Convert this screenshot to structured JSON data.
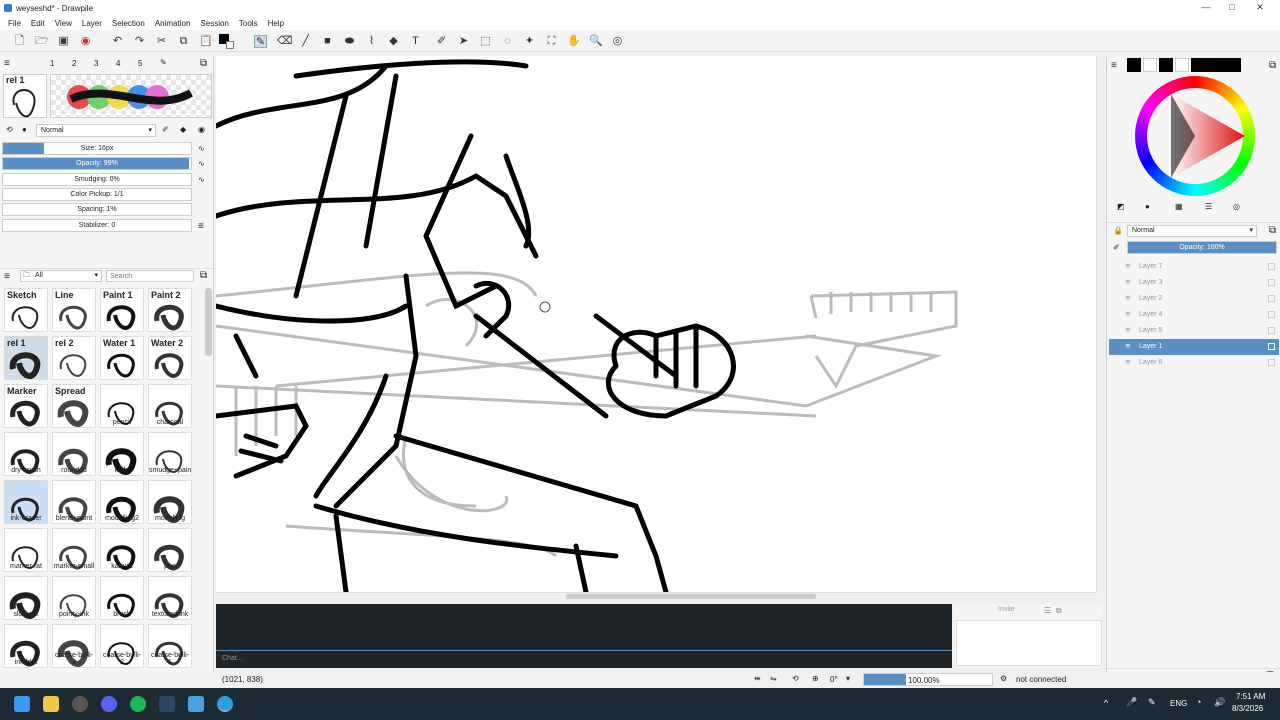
{
  "window": {
    "title": "weyseshd* - Drawpile",
    "minimize": "—",
    "maximize": "□",
    "close": "✕"
  },
  "menu": [
    "File",
    "Edit",
    "View",
    "Layer",
    "Selection",
    "Animation",
    "Session",
    "Tools",
    "Help"
  ],
  "brush_settings": {
    "preset_tabs": [
      "1",
      "2",
      "3",
      "4",
      "5"
    ],
    "current_brush": "rel 1",
    "blend_mode": "Normal",
    "sliders": [
      {
        "label": "Size: 16px",
        "fraction": 0.22
      },
      {
        "label": "Opacity: 99%",
        "fraction": 0.99
      },
      {
        "label": "Smudging: 0%",
        "fraction": 0
      },
      {
        "label": "Color Pickup: 1/1",
        "fraction": 0
      },
      {
        "label": "Spacing: 1%",
        "fraction": 0
      },
      {
        "label": "Stabilizer: 0",
        "fraction": 0
      }
    ]
  },
  "brushes": {
    "filter": "All",
    "search_placeholder": "Search",
    "items": [
      {
        "title": "Sketch",
        "label": ""
      },
      {
        "title": "Line",
        "label": ""
      },
      {
        "title": "Paint 1",
        "label": ""
      },
      {
        "title": "Paint 2",
        "label": ""
      },
      {
        "title": "rel 1",
        "label": ""
      },
      {
        "title": "rel 2",
        "label": ""
      },
      {
        "title": "Water 1",
        "label": ""
      },
      {
        "title": "Water 2",
        "label": ""
      },
      {
        "title": "Marker",
        "label": ""
      },
      {
        "title": "Spread",
        "label": ""
      },
      {
        "title": "",
        "label": "pencil"
      },
      {
        "title": "",
        "label": "charcoal"
      },
      {
        "title": "",
        "label": "dry-brush"
      },
      {
        "title": "",
        "label": "rounded"
      },
      {
        "title": "",
        "label": "knife"
      },
      {
        "title": "",
        "label": "smudge+paint"
      },
      {
        "title": "",
        "label": "ink-eraser"
      },
      {
        "title": "",
        "label": "blend+paint"
      },
      {
        "title": "",
        "label": "modelling2"
      },
      {
        "title": "",
        "label": "modelling"
      },
      {
        "title": "",
        "label": "marker-fat"
      },
      {
        "title": "",
        "label": "marker-small"
      },
      {
        "title": "",
        "label": "kabura"
      },
      {
        "title": "",
        "label": "pen"
      },
      {
        "title": "",
        "label": "slow-ink"
      },
      {
        "title": "",
        "label": "pointy-ink"
      },
      {
        "title": "",
        "label": "brush"
      },
      {
        "title": "",
        "label": "textured-ink"
      },
      {
        "title": "",
        "label": "ink-blot"
      },
      {
        "title": "",
        "label": "coarse-bulli-3"
      },
      {
        "title": "",
        "label": "coarse-bulli-2"
      },
      {
        "title": "",
        "label": "coarse-bulli-1"
      }
    ]
  },
  "chat": {
    "placeholder": "Chat...",
    "invite_label": "Invite"
  },
  "layers": {
    "blend_mode": "Normal",
    "opacity_label": "Opacity: 100%",
    "opacity_fraction": 1.0,
    "items": [
      {
        "name": "Layer 7",
        "selected": false
      },
      {
        "name": "Layer 3",
        "selected": false
      },
      {
        "name": "Layer 2",
        "selected": false
      },
      {
        "name": "Layer 4",
        "selected": false
      },
      {
        "name": "Layer 5",
        "selected": false
      },
      {
        "name": "Layer 1",
        "selected": true
      },
      {
        "name": "Layer 6",
        "selected": false
      }
    ]
  },
  "status": {
    "coordinates": "(1021, 838)",
    "rotation": "0°",
    "zoom": "100.00%",
    "connection": "not connected"
  },
  "taskbar": {
    "language": "ENG",
    "time": "7:51 AM",
    "date": "8/3/2026"
  },
  "colors": {
    "accent": "#5b8fc4",
    "taskbar": "#1c2b33",
    "chat_bg": "#1f2529"
  }
}
